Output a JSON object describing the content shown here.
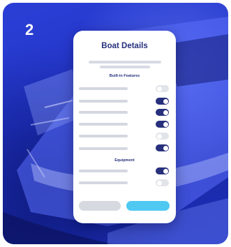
{
  "step": {
    "number": "2"
  },
  "card": {
    "title": "Boat Details",
    "sections": [
      {
        "heading": "Built-in Features",
        "toggles": [
          {
            "state": "off"
          },
          {
            "state": "on"
          },
          {
            "state": "on"
          },
          {
            "state": "on"
          },
          {
            "state": "off"
          },
          {
            "state": "on"
          }
        ]
      },
      {
        "heading": "Equipment",
        "toggles": [
          {
            "state": "on"
          },
          {
            "state": "off"
          }
        ]
      }
    ]
  },
  "colors": {
    "background_blue": "#2235c9",
    "toggle_on": "#27307c",
    "toggle_off": "#e2e4ea",
    "primary_button": "#4fc9f2",
    "secondary_button": "#d7d9e0",
    "title_text": "#26307d"
  }
}
